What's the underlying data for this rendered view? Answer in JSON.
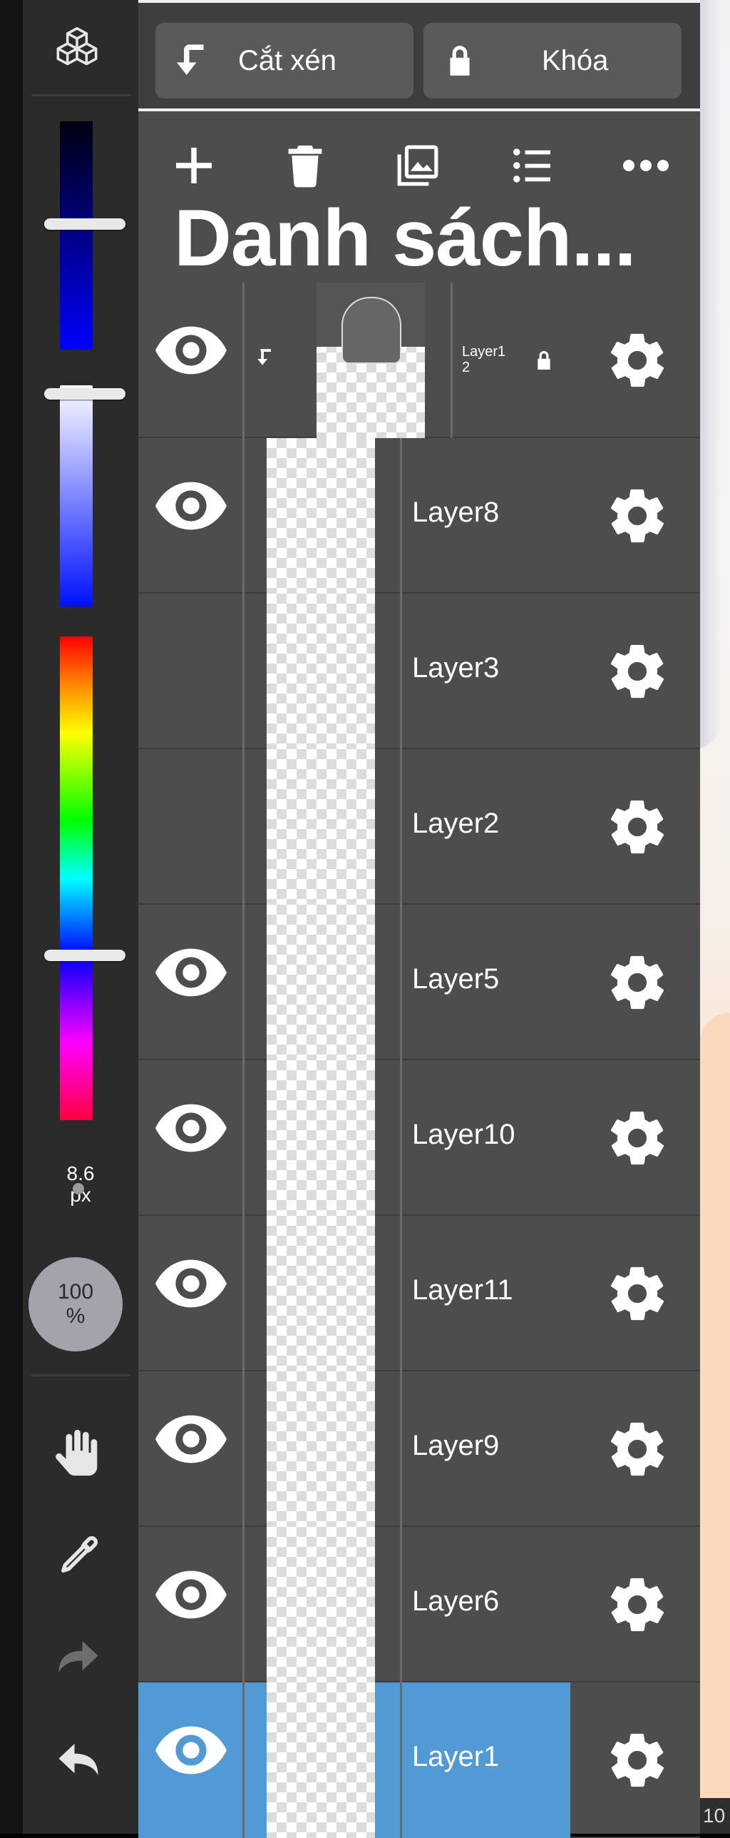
{
  "toolbar_top": {
    "clip_label": "Cắt xén",
    "lock_label": "Khóa"
  },
  "panel": {
    "title": "Danh sách..."
  },
  "tools": {
    "brush_size": "8.6",
    "brush_size_unit": "px",
    "opacity_value": "100",
    "opacity_unit": "%"
  },
  "sliders": {
    "blue_level": 0.45,
    "white_level": 0.04,
    "hue_level": 0.66
  },
  "layers": [
    {
      "name": "Layer1\n2",
      "visible": true,
      "clipped": true,
      "locked": true,
      "selected": false
    },
    {
      "name": "Layer8",
      "visible": true,
      "clipped": false,
      "locked": false,
      "selected": false
    },
    {
      "name": "Layer3",
      "visible": false,
      "clipped": false,
      "locked": false,
      "selected": false
    },
    {
      "name": "Layer2",
      "visible": false,
      "clipped": false,
      "locked": false,
      "selected": false
    },
    {
      "name": "Layer5",
      "visible": true,
      "clipped": false,
      "locked": false,
      "selected": false
    },
    {
      "name": "Layer10",
      "visible": true,
      "clipped": false,
      "locked": false,
      "selected": false
    },
    {
      "name": "Layer11",
      "visible": true,
      "clipped": false,
      "locked": false,
      "selected": false
    },
    {
      "name": "Layer9",
      "visible": true,
      "clipped": false,
      "locked": false,
      "selected": false
    },
    {
      "name": "Layer6",
      "visible": true,
      "clipped": false,
      "locked": false,
      "selected": false
    },
    {
      "name": "Layer1",
      "visible": true,
      "clipped": false,
      "locked": false,
      "selected": true
    }
  ],
  "canvas": {
    "zoom_text": "10"
  },
  "colors": {
    "accent": "#519ad6",
    "panel_bg": "#4d4d4d",
    "strip_bg": "#2b2b2b"
  }
}
